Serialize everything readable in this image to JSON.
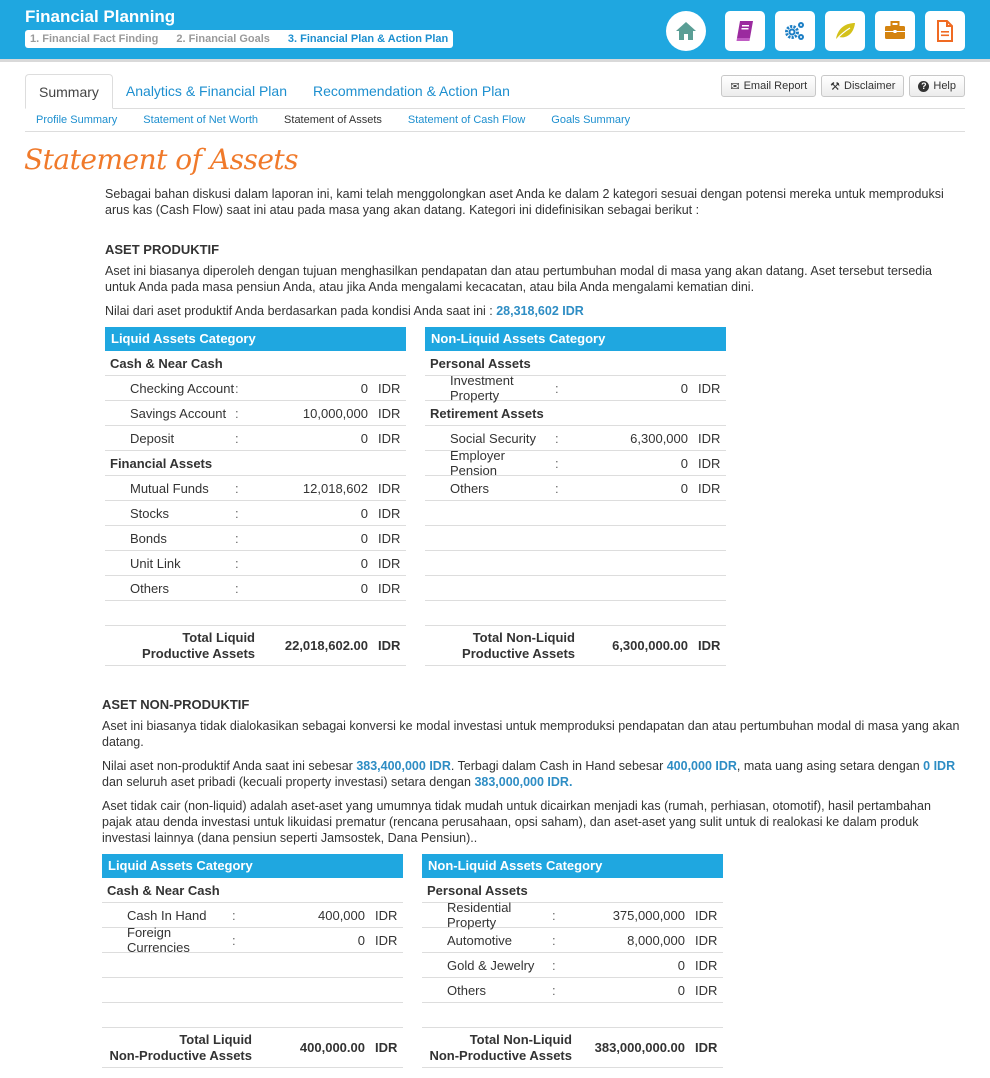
{
  "header": {
    "title": "Financial Planning",
    "steps": [
      "1. Financial Fact Finding",
      "2. Financial Goals",
      "3. Financial Plan & Action Plan"
    ],
    "icons": [
      "home-icon",
      "book-icon",
      "gears-icon",
      "leaf-icon",
      "briefcase-icon",
      "document-icon"
    ],
    "icon_colors": {
      "home": "#5a9e95",
      "book": "#9b2a9f",
      "gears": "#1d7fc5",
      "leaf": "#d4c11a",
      "briefcase": "#d4830f",
      "document": "#f06a22"
    }
  },
  "tabs": [
    "Summary",
    "Analytics & Financial Plan",
    "Recommendation & Action Plan"
  ],
  "buttons": {
    "email": "Email Report",
    "disclaimer": "Disclaimer",
    "help": "Help"
  },
  "subtabs": [
    "Profile Summary",
    "Statement of Net Worth",
    "Statement of Assets",
    "Statement of Cash Flow",
    "Goals Summary"
  ],
  "page_title": "Statement of Assets",
  "intro": "Sebagai bahan diskusi dalam laporan ini, kami telah menggolongkan aset Anda ke dalam 2 kategori sesuai dengan potensi mereka untuk memproduksi arus kas (Cash Flow) saat ini atau pada masa yang akan datang. Kategori ini didefinisikan sebagai berikut :",
  "productive": {
    "heading": "ASET PRODUKTIF",
    "desc": "Aset ini biasanya diperoleh dengan tujuan menghasilkan pendapatan dan atau pertumbuhan modal di masa yang akan datang. Aset tersebut tersedia untuk Anda pada masa pensiun Anda, atau jika Anda mengalami kecacatan, atau bila Anda mengalami kematian dini.",
    "value_text": "Nilai dari aset produktif Anda berdasarkan pada kondisi Anda saat ini : ",
    "value": "28,318,602 IDR",
    "liquid": {
      "title": "Liquid Assets Category",
      "groups": [
        {
          "name": "Cash & Near Cash",
          "items": [
            {
              "label": "Checking Account",
              "value": "0",
              "cur": "IDR"
            },
            {
              "label": "Savings Account",
              "value": "10,000,000",
              "cur": "IDR"
            },
            {
              "label": "Deposit",
              "value": "0",
              "cur": "IDR"
            }
          ]
        },
        {
          "name": "Financial Assets",
          "items": [
            {
              "label": "Mutual Funds",
              "value": "12,018,602",
              "cur": "IDR"
            },
            {
              "label": "Stocks",
              "value": "0",
              "cur": "IDR"
            },
            {
              "label": "Bonds",
              "value": "0",
              "cur": "IDR"
            },
            {
              "label": "Unit Link",
              "value": "0",
              "cur": "IDR"
            },
            {
              "label": "Others",
              "value": "0",
              "cur": "IDR"
            }
          ]
        }
      ],
      "total_label": [
        "Total Liquid",
        "Productive Assets"
      ],
      "total": "22,018,602.00",
      "total_cur": "IDR"
    },
    "nonliquid": {
      "title": "Non-Liquid Assets Category",
      "groups": [
        {
          "name": "Personal Assets",
          "items": [
            {
              "label": "Investment Property",
              "value": "0",
              "cur": "IDR"
            }
          ]
        },
        {
          "name": "Retirement Assets",
          "items": [
            {
              "label": "Social Security",
              "value": "6,300,000",
              "cur": "IDR"
            },
            {
              "label": "Employer Pension",
              "value": "0",
              "cur": "IDR"
            },
            {
              "label": "Others",
              "value": "0",
              "cur": "IDR"
            }
          ]
        }
      ],
      "total_label": [
        "Total Non-Liquid",
        "Productive Assets"
      ],
      "total": "6,300,000.00",
      "total_cur": "IDR"
    }
  },
  "nonproductive": {
    "heading": "ASET NON-PRODUKTIF",
    "desc": "Aset ini biasanya tidak dialokasikan sebagai konversi ke modal investasi untuk memproduksi pendapatan dan atau pertumbuhan modal di masa yang akan datang.",
    "value_parts": [
      "Nilai aset non-produktif Anda saat ini sebesar ",
      "383,400,000 IDR",
      ". Terbagi dalam Cash in Hand sebesar ",
      "400,000 IDR",
      ", mata uang asing setara dengan ",
      "0 IDR",
      " dan seluruh aset pribadi (kecuali property investasi) setara dengan ",
      "383,000,000 IDR."
    ],
    "desc2": "Aset tidak cair (non-liquid) adalah aset-aset yang umumnya tidak mudah untuk dicairkan menjadi kas (rumah, perhiasan, otomotif), hasil pertambahan pajak atau denda investasi untuk likuidasi prematur (rencana perusahaan, opsi saham), dan aset-aset yang sulit untuk di realokasi ke dalam produk investasi lainnya (dana pensiun seperti Jamsostek, Dana Pensiun)..",
    "liquid": {
      "title": "Liquid Assets Category",
      "groups": [
        {
          "name": "Cash & Near Cash",
          "items": [
            {
              "label": "Cash In Hand",
              "value": "400,000",
              "cur": "IDR"
            },
            {
              "label": "Foreign Currencies",
              "value": "0",
              "cur": "IDR"
            }
          ]
        }
      ],
      "total_label": [
        "Total Liquid",
        "Non-Productive Assets"
      ],
      "total": "400,000.00",
      "total_cur": "IDR"
    },
    "nonliquid": {
      "title": "Non-Liquid Assets Category",
      "groups": [
        {
          "name": "Personal Assets",
          "items": [
            {
              "label": "Residential Property",
              "value": "375,000,000",
              "cur": "IDR"
            },
            {
              "label": "Automotive",
              "value": "8,000,000",
              "cur": "IDR"
            },
            {
              "label": "Gold & Jewelry",
              "value": "0",
              "cur": "IDR"
            },
            {
              "label": "Others",
              "value": "0",
              "cur": "IDR"
            }
          ]
        }
      ],
      "total_label": [
        "Total Non-Liquid",
        "Non-Productive Assets"
      ],
      "total": "383,000,000.00",
      "total_cur": "IDR"
    }
  }
}
